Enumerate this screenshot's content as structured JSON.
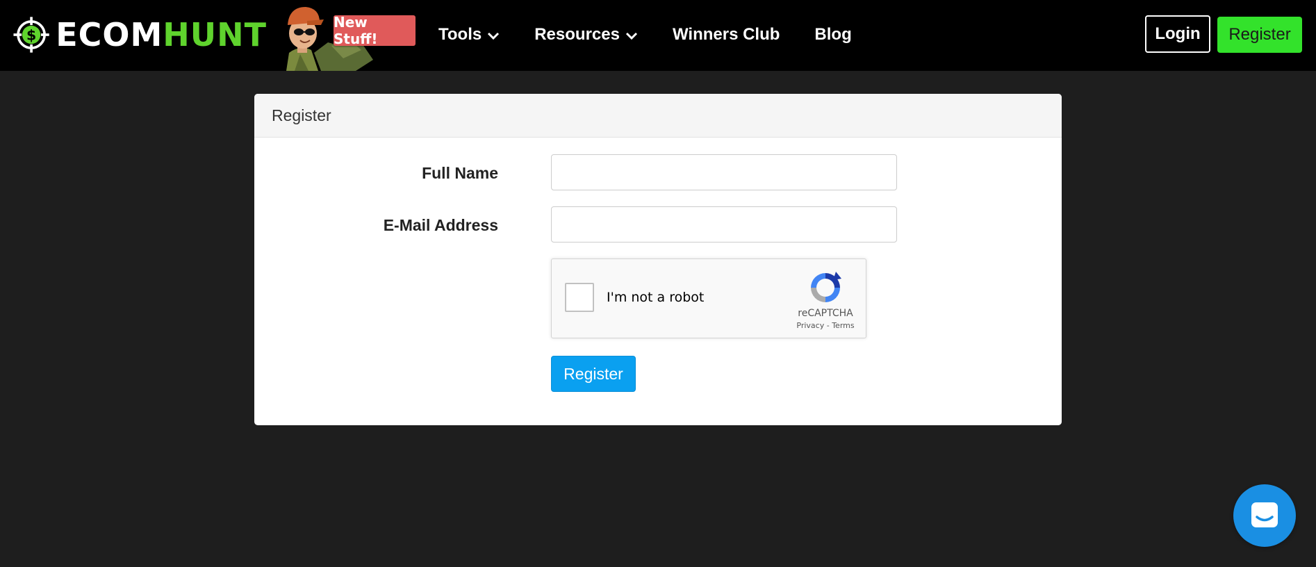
{
  "nav": {
    "brand_part1": "ECOM",
    "brand_part2": "HUNT",
    "badge": "New Stuff!",
    "links": [
      {
        "label": "Tools"
      },
      {
        "label": "Resources"
      },
      {
        "label": "Winners Club"
      },
      {
        "label": "Blog"
      }
    ],
    "login_label": "Login",
    "register_label": "Register"
  },
  "form": {
    "title": "Register",
    "full_name_label": "Full Name",
    "full_name_value": "",
    "email_label": "E-Mail Address",
    "email_value": "",
    "recaptcha": {
      "label": "I'm not a robot",
      "brand": "reCAPTCHA",
      "terms": "Privacy - Terms"
    },
    "submit_label": "Register"
  },
  "colors": {
    "nav_bg": "#000000",
    "page_bg": "#1e1e1e",
    "brand_green": "#5fd32d",
    "register_nav_green": "#33e22b",
    "submit_blue": "#0aa0f0",
    "badge_red": "#e05a5a",
    "chat_blue": "#1a8fe3"
  },
  "icons": {
    "logo": "crosshair-dollar-icon",
    "chevron": "chevron-down-icon",
    "chat": "chat-icon",
    "recaptcha": "recaptcha-logo-icon"
  }
}
